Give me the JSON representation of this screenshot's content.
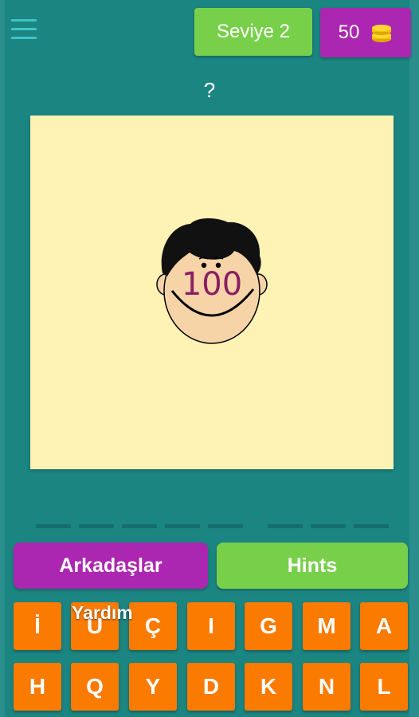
{
  "header": {
    "menu_icon": "hamburger-menu-icon",
    "level_label": "Seviye 2",
    "coins": "50",
    "coin_icon": "coin-stack-icon"
  },
  "question": "?",
  "picture": {
    "face_text": "100",
    "background": "#fff2b5"
  },
  "answer_slot_groups": [
    5,
    3
  ],
  "buttons": {
    "friends": "Arkadaşlar",
    "friends_sub": "Yardım",
    "hints": "Hints"
  },
  "keyboard": {
    "row1": [
      "İ",
      "U",
      "Ç",
      "I",
      "G",
      "M",
      "A"
    ],
    "row2": [
      "H",
      "Q",
      "Y",
      "D",
      "K",
      "N",
      "L"
    ]
  },
  "colors": {
    "background": "#1b8581",
    "green": "#78d04a",
    "purple": "#ac27b1",
    "orange": "#fb7a00"
  }
}
